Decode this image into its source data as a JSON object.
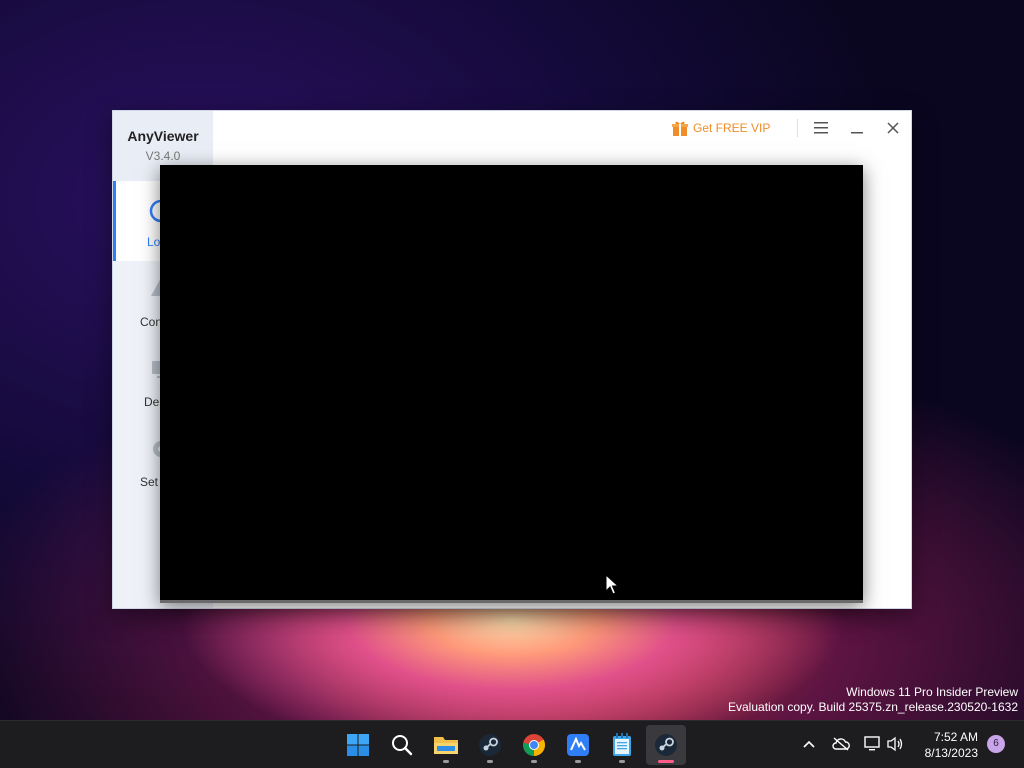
{
  "app": {
    "name": "AnyViewer",
    "version": "V3.4.0",
    "vip_label": "Get FREE VIP",
    "nav": [
      {
        "label": "Lo",
        "active": true
      },
      {
        "label": "Con"
      },
      {
        "label": "De"
      },
      {
        "label": "Set"
      }
    ]
  },
  "watermark": {
    "line1": "Windows 11 Pro Insider Preview",
    "line2": "Evaluation copy. Build 25375.zn_release.230520-1632"
  },
  "taskbar": {
    "apps": [
      "start-icon",
      "search-icon",
      "file-explorer-icon",
      "steam-icon",
      "chrome-icon",
      "anyviewer-icon",
      "notepad-icon",
      "steam-active-icon"
    ],
    "time": "7:52 AM",
    "date": "8/13/2023",
    "notification_count": "6"
  },
  "colors": {
    "accent": "#2f7ef6",
    "vip": "#ef8d2a",
    "taskbar": "#1d1d1f"
  }
}
